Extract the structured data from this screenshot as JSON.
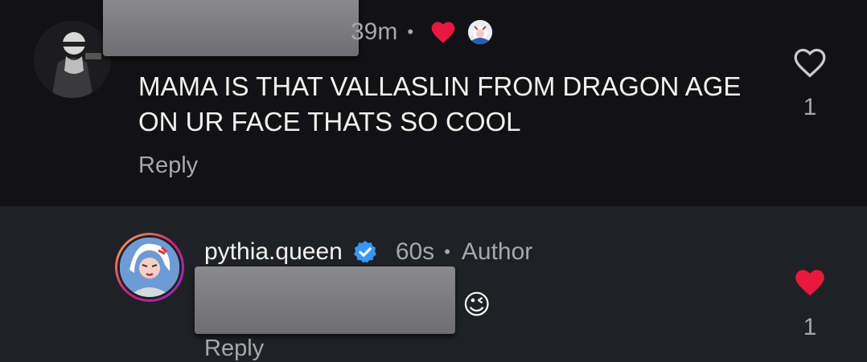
{
  "top_comment": {
    "time": "39m",
    "separator": "•",
    "text": "MAMA IS THAT VALLASLIN FROM DRAGON AGE ON UR FACE THATS SO COOL",
    "reply_label": "Reply",
    "like_count": "1",
    "creator_liked": true,
    "colors": {
      "heart": "#e8193c",
      "meta": "#a6a8ad"
    }
  },
  "author_reply": {
    "username": "pythia.queen",
    "verified": true,
    "time": "60s",
    "separator": "•",
    "author_label": "Author",
    "emoji": "😉",
    "reply_label": "Reply",
    "like_count": "1",
    "liked": true,
    "colors": {
      "heart": "#e8193c",
      "verified": "#3897f0",
      "background": "#1f2126"
    }
  }
}
